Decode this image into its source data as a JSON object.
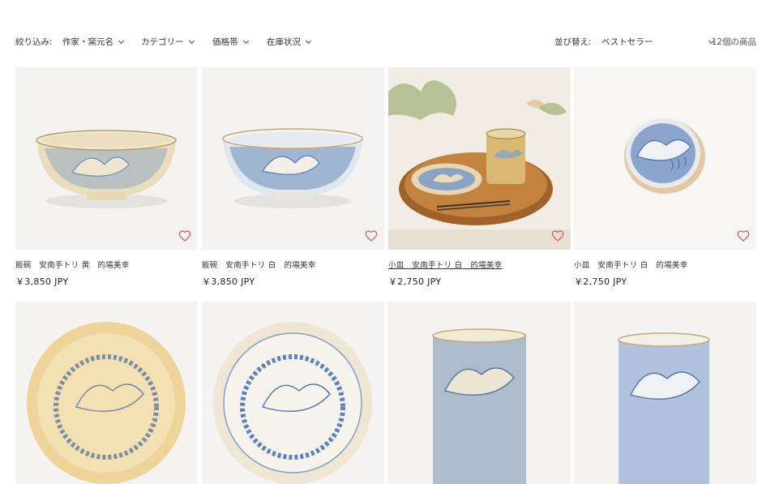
{
  "filters": {
    "label": "絞り込み:",
    "items": [
      {
        "label": "作家・窯元名"
      },
      {
        "label": "カテゴリー"
      },
      {
        "label": "価格帯"
      },
      {
        "label": "在庫状況"
      }
    ]
  },
  "sort": {
    "label": "並び替え:",
    "value": "ベストセラー"
  },
  "product_count": "12個の商品",
  "products": [
    {
      "title": "飯碗　安南手トリ 黄　的場美幸",
      "price": "￥3,850 JPY"
    },
    {
      "title": "飯碗　安南手トリ 白　的場美幸",
      "price": "￥3,850 JPY"
    },
    {
      "title": "小皿　安南手トリ 白　的場美幸",
      "price": "￥2,750 JPY"
    },
    {
      "title": "小皿　安南手トリ 白　的場美幸",
      "price": "￥2,750 JPY"
    },
    {
      "title": "",
      "price": ""
    },
    {
      "title": "",
      "price": ""
    },
    {
      "title": "",
      "price": ""
    },
    {
      "title": "",
      "price": ""
    }
  ],
  "colors": {
    "heart": "#d05a5a",
    "glaze_blue": "#6e8fb8",
    "cream": "#efe6cf",
    "wood": "#b9773d"
  },
  "icons": {
    "favorite": "heart-outline-icon",
    "dropdown": "chevron-down-icon"
  }
}
